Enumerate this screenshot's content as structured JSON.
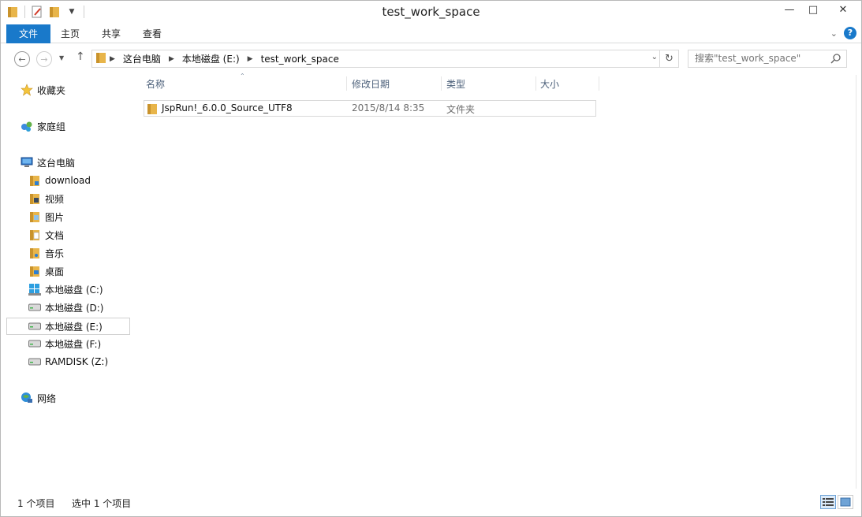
{
  "window": {
    "title": "test_work_space"
  },
  "ribbon": {
    "tabs": [
      "文件",
      "主页",
      "共享",
      "查看"
    ]
  },
  "address": {
    "breadcrumbs": [
      "这台电脑",
      "本地磁盘 (E:)",
      "test_work_space"
    ]
  },
  "search": {
    "placeholder": "搜索\"test_work_space\""
  },
  "sidebar": {
    "items": [
      {
        "label": "收藏夹",
        "icon": "star-icon"
      },
      {
        "label": "家庭组",
        "icon": "homegroup-icon"
      },
      {
        "label": "这台电脑",
        "icon": "computer-icon"
      },
      {
        "label": "download",
        "icon": "folder-download-icon"
      },
      {
        "label": "视频",
        "icon": "folder-video-icon"
      },
      {
        "label": "图片",
        "icon": "folder-pictures-icon"
      },
      {
        "label": "文档",
        "icon": "folder-documents-icon"
      },
      {
        "label": "音乐",
        "icon": "folder-music-icon"
      },
      {
        "label": "桌面",
        "icon": "folder-desktop-icon"
      },
      {
        "label": "本地磁盘 (C:)",
        "icon": "windows-drive-icon"
      },
      {
        "label": "本地磁盘 (D:)",
        "icon": "drive-icon"
      },
      {
        "label": "本地磁盘 (E:)",
        "icon": "drive-icon",
        "selected": true
      },
      {
        "label": "本地磁盘 (F:)",
        "icon": "drive-icon"
      },
      {
        "label": "RAMDISK (Z:)",
        "icon": "drive-icon"
      },
      {
        "label": "网络",
        "icon": "network-icon"
      }
    ]
  },
  "columns": [
    "名称",
    "修改日期",
    "类型",
    "大小"
  ],
  "files": [
    {
      "name": "JspRun!_6.0.0_Source_UTF8",
      "modified": "2015/8/14 8:35",
      "type": "文件夹",
      "size": ""
    }
  ],
  "status": {
    "item_count": "1 个项目",
    "selected": "选中 1 个项目"
  },
  "colors": {
    "accent": "#1979ca",
    "header_text": "#4c607a",
    "folder": "#e8b54a"
  }
}
